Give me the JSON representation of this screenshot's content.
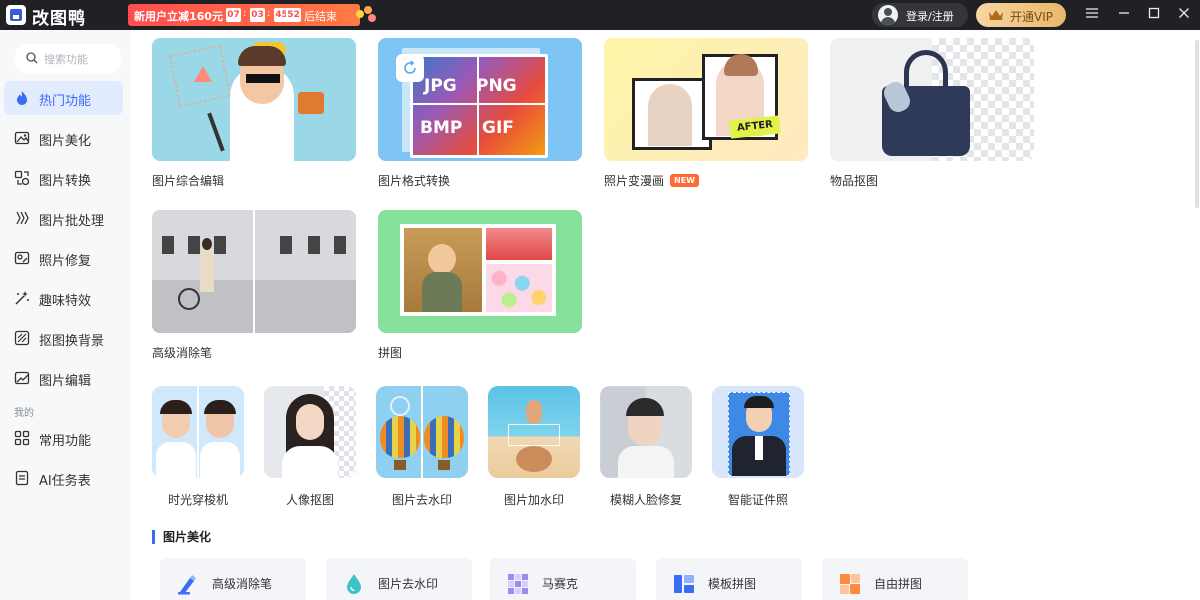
{
  "app": {
    "title": "改图鸭"
  },
  "promo": {
    "label": "新用户立减160元",
    "countdown": [
      "07",
      "03",
      "45",
      "52"
    ],
    "suffix": "后结束"
  },
  "header": {
    "login_label": "登录/注册",
    "vip_label": "开通VIP"
  },
  "window_controls": [
    "menu-icon",
    "minimize-icon",
    "maximize-icon",
    "close-icon"
  ],
  "sidebar": {
    "search_placeholder": "搜索功能",
    "items": [
      {
        "label": "热门功能",
        "icon": "flame-icon",
        "active": true
      },
      {
        "label": "图片美化",
        "icon": "image-beautify-icon"
      },
      {
        "label": "图片转换",
        "icon": "convert-icon"
      },
      {
        "label": "图片批处理",
        "icon": "batch-icon"
      },
      {
        "label": "照片修复",
        "icon": "photo-repair-icon"
      },
      {
        "label": "趣味特效",
        "icon": "magic-wand-icon"
      },
      {
        "label": "抠图换背景",
        "icon": "cutout-icon"
      },
      {
        "label": "图片编辑",
        "icon": "image-edit-icon"
      }
    ],
    "section_label": "我的",
    "my_items": [
      {
        "label": "常用功能",
        "icon": "grid-icon"
      },
      {
        "label": "AI任务表",
        "icon": "task-list-icon"
      }
    ]
  },
  "cards": [
    {
      "label": "图片综合编辑"
    },
    {
      "label": "图片格式转换",
      "formats": [
        "JPG",
        "PNG",
        "BMP",
        "GIF"
      ]
    },
    {
      "label": "照片变漫画",
      "badge": "NEW",
      "after_tag": "AFTER"
    },
    {
      "label": "物品抠图"
    },
    {
      "label": "高级消除笔"
    },
    {
      "label": "拼图"
    }
  ],
  "tiles": [
    {
      "label": "时光穿梭机"
    },
    {
      "label": "人像抠图"
    },
    {
      "label": "图片去水印"
    },
    {
      "label": "图片加水印"
    },
    {
      "label": "模糊人脸修复"
    },
    {
      "label": "智能证件照"
    }
  ],
  "beautify_section": {
    "title": "图片美化",
    "tools": [
      {
        "label": "高级消除笔",
        "icon": "eraser-pen-icon"
      },
      {
        "label": "图片去水印",
        "icon": "water-drop-icon"
      },
      {
        "label": "马赛克",
        "icon": "mosaic-icon"
      },
      {
        "label": "模板拼图",
        "icon": "template-collage-icon"
      },
      {
        "label": "自由拼图",
        "icon": "free-collage-icon"
      }
    ]
  },
  "colors": {
    "accent": "#3b6cf6",
    "titlebar": "#202124",
    "sidebar_bg": "#f7f8fa",
    "promo": "#ff4d4f",
    "vip": "#e9b86a"
  }
}
